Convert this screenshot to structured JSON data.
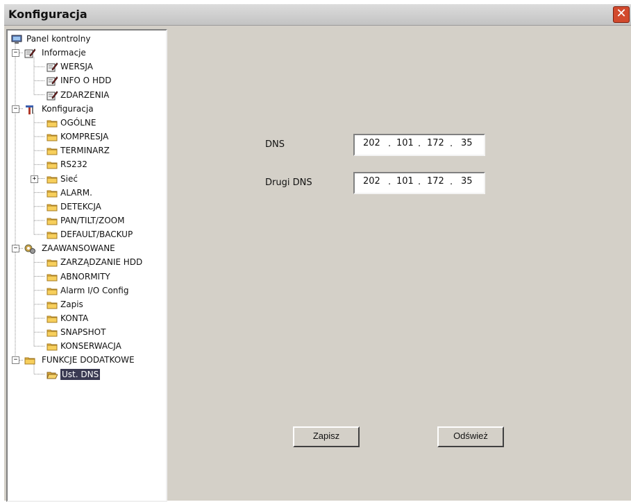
{
  "window": {
    "title": "Konfiguracja",
    "close_glyph": "✕"
  },
  "tree": [
    {
      "label": "Panel kontrolny",
      "icon": "monitor-icon",
      "expander": ""
    },
    {
      "label": "Informacje",
      "icon": "notepad-pencil-icon",
      "expander": "−"
    },
    {
      "label": "WERSJA",
      "icon": "notepad-pencil-icon",
      "expander": ""
    },
    {
      "label": "INFO O HDD",
      "icon": "notepad-pencil-icon",
      "expander": ""
    },
    {
      "label": "ZDARZENIA",
      "icon": "notepad-pencil-icon",
      "expander": ""
    },
    {
      "label": "Konfiguracja",
      "icon": "tools-icon",
      "expander": "−"
    },
    {
      "label": "OGÓLNE",
      "icon": "folder-icon",
      "expander": ""
    },
    {
      "label": "KOMPRESJA",
      "icon": "folder-icon",
      "expander": ""
    },
    {
      "label": "TERMINARZ",
      "icon": "folder-icon",
      "expander": ""
    },
    {
      "label": "RS232",
      "icon": "folder-icon",
      "expander": ""
    },
    {
      "label": "Sieć",
      "icon": "folder-icon",
      "expander": "+"
    },
    {
      "label": "ALARM.",
      "icon": "folder-icon",
      "expander": ""
    },
    {
      "label": "DETEKCJA",
      "icon": "folder-icon",
      "expander": ""
    },
    {
      "label": "PAN/TILT/ZOOM",
      "icon": "folder-icon",
      "expander": ""
    },
    {
      "label": "DEFAULT/BACKUP",
      "icon": "folder-icon",
      "expander": ""
    },
    {
      "label": "ZAAWANSOWANE",
      "icon": "gears-icon",
      "expander": "−"
    },
    {
      "label": "ZARZĄDZANIE HDD",
      "icon": "folder-icon",
      "expander": ""
    },
    {
      "label": "ABNORMITY",
      "icon": "folder-icon",
      "expander": ""
    },
    {
      "label": "Alarm I/O Config",
      "icon": "folder-icon",
      "expander": ""
    },
    {
      "label": "Zapis",
      "icon": "folder-icon",
      "expander": ""
    },
    {
      "label": "KONTA",
      "icon": "folder-icon",
      "expander": ""
    },
    {
      "label": "SNAPSHOT",
      "icon": "folder-icon",
      "expander": ""
    },
    {
      "label": "KONSERWACJA",
      "icon": "folder-icon",
      "expander": ""
    },
    {
      "label": "FUNKCJE DODATKOWE",
      "icon": "folder-icon",
      "expander": "−"
    },
    {
      "label": "Ust. DNS",
      "icon": "open-folder-icon",
      "expander": "",
      "selected": true
    }
  ],
  "form": {
    "dns": {
      "label": "DNS",
      "octets": [
        "202",
        "101",
        "172",
        "35"
      ]
    },
    "dns2": {
      "label": "Drugi DNS",
      "octets": [
        "202",
        "101",
        "172",
        "35"
      ]
    },
    "separator": "."
  },
  "buttons": {
    "save": "Zapisz",
    "refresh": "Odśwież"
  },
  "colors": {
    "panel": "#d4d0c8",
    "selection": "#3a3a52",
    "folder": "#f2c14a",
    "close": "#d24a2d"
  }
}
